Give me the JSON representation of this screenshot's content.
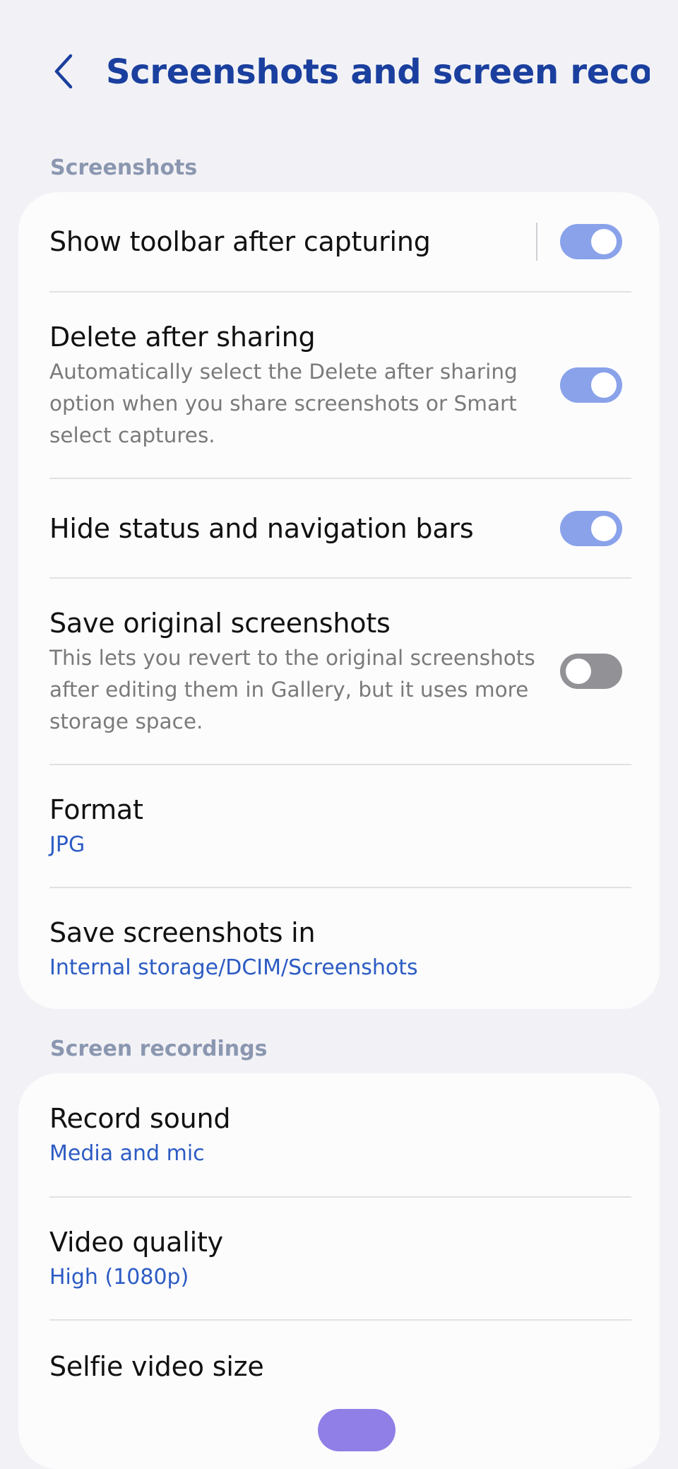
{
  "header": {
    "back_icon": "chevron-left-icon",
    "title": "Screenshots and screen reco..."
  },
  "sections": {
    "screenshots": {
      "label": "Screenshots",
      "items": {
        "show_toolbar": {
          "title": "Show toolbar after capturing",
          "toggle": "on"
        },
        "delete_after_sharing": {
          "title": "Delete after sharing",
          "description": "Automatically select the Delete after sharing option when you share screenshots or Smart select captures.",
          "toggle": "on"
        },
        "hide_bars": {
          "title": "Hide status and navigation bars",
          "toggle": "on"
        },
        "save_original": {
          "title": "Save original screenshots",
          "description": "This lets you revert to the original screenshots after editing them in Gallery, but it uses more storage space.",
          "toggle": "off"
        },
        "format": {
          "title": "Format",
          "value": "JPG"
        },
        "save_location": {
          "title": "Save screenshots in",
          "value": "Internal storage/DCIM/Screenshots"
        }
      }
    },
    "screen_recordings": {
      "label": "Screen recordings",
      "items": {
        "record_sound": {
          "title": "Record sound",
          "value": "Media and mic"
        },
        "video_quality": {
          "title": "Video quality",
          "value": "High (1080p)"
        },
        "selfie_video_size": {
          "title": "Selfie video size"
        }
      }
    }
  },
  "colors": {
    "title": "#1a3f9e",
    "accent_value": "#2c5bc3",
    "toggle_on": "#89a2ea",
    "toggle_off": "#929296",
    "background": "#f2f2f6",
    "card": "#fcfcfd"
  }
}
